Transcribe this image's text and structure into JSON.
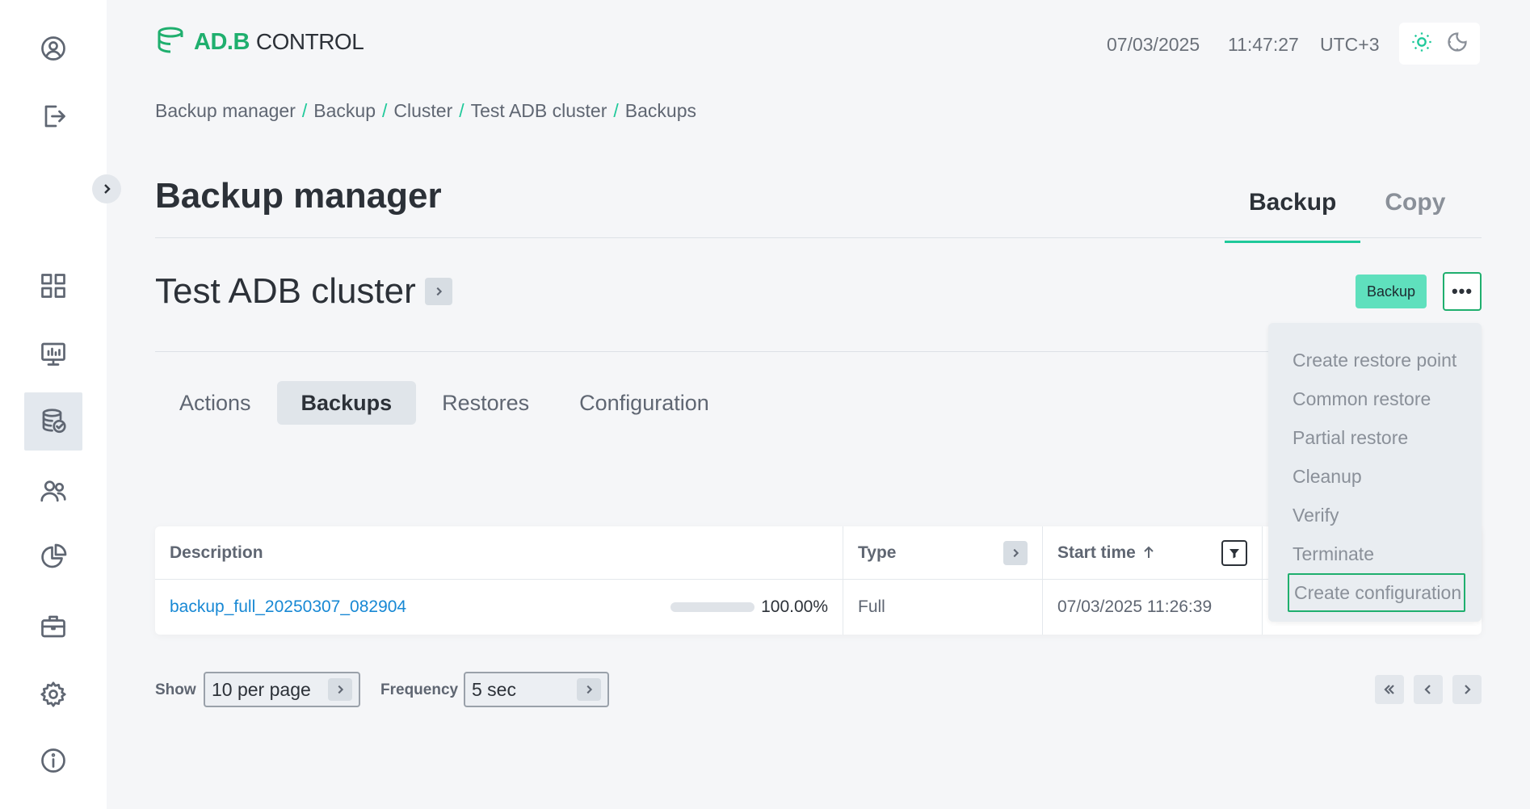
{
  "header": {
    "logo_brand": "AD.B",
    "logo_product": "CONTROL",
    "date": "07/03/2025",
    "time": "11:47:27",
    "timezone": "UTC+3"
  },
  "sidebar": {
    "top_items": [
      {
        "icon": "user-circle-icon"
      },
      {
        "icon": "logout-icon"
      }
    ],
    "nav_items": [
      {
        "icon": "dashboard-grid-icon"
      },
      {
        "icon": "monitoring-icon"
      },
      {
        "icon": "backup-database-icon",
        "active": true
      },
      {
        "icon": "users-icon"
      },
      {
        "icon": "pie-chart-icon"
      },
      {
        "icon": "briefcase-icon"
      },
      {
        "icon": "gear-icon"
      },
      {
        "icon": "info-icon"
      }
    ]
  },
  "breadcrumb": [
    "Backup manager",
    "Backup",
    "Cluster",
    "Test ADB cluster",
    "Backups"
  ],
  "page": {
    "title": "Backup manager",
    "top_tabs": [
      {
        "label": "Backup",
        "active": true
      },
      {
        "label": "Copy",
        "active": false
      }
    ]
  },
  "cluster": {
    "name": "Test ADB cluster",
    "backup_button": "Backup",
    "more_button": "•••"
  },
  "menu": {
    "items": [
      "Create restore point",
      "Common restore",
      "Partial restore",
      "Cleanup",
      "Verify",
      "Terminate",
      "Create configuration"
    ],
    "focused": "Create configuration"
  },
  "sub_tabs": [
    {
      "label": "Actions",
      "active": false
    },
    {
      "label": "Backups",
      "active": true
    },
    {
      "label": "Restores",
      "active": false
    },
    {
      "label": "Configuration",
      "active": false
    }
  ],
  "table": {
    "headers": [
      "Description",
      "Type",
      "Start time",
      ""
    ],
    "rows": [
      {
        "description": "backup_full_20250307_082904",
        "progress": 100,
        "progress_text": "100.00%",
        "type": "Full",
        "start_time": "07/03/2025 11:26:39"
      }
    ]
  },
  "footer": {
    "show_label": "Show",
    "per_page": "10 per page",
    "frequency_label": "Frequency",
    "frequency": "5 sec"
  },
  "colors": {
    "accent": "#1fc99a",
    "brand_green": "#1faf6e",
    "link": "#1788d4",
    "backup_button": "#5fe0bd"
  }
}
